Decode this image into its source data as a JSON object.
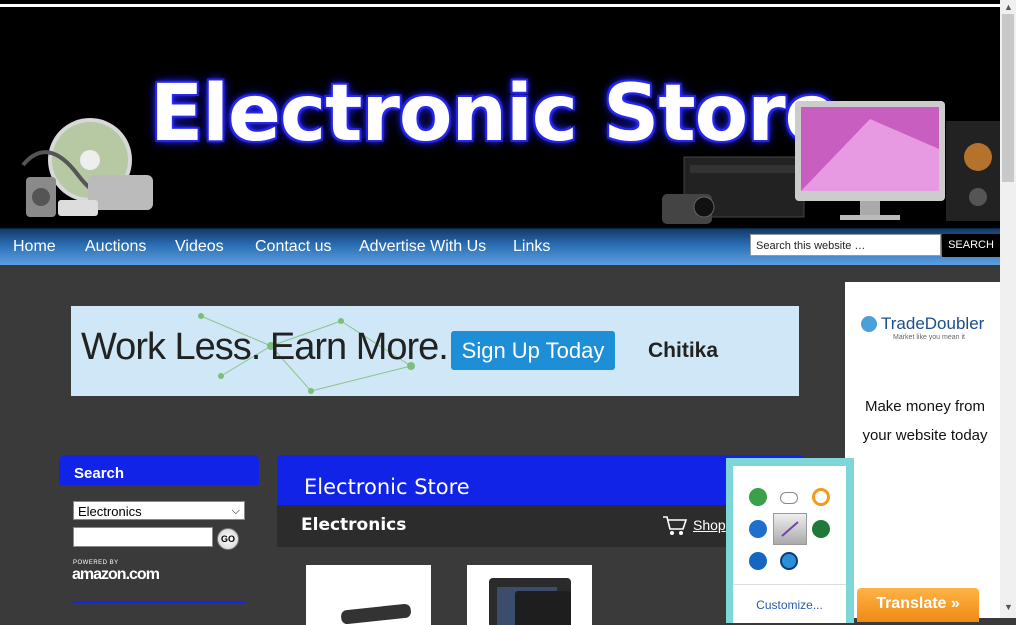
{
  "header": {
    "title": "Electronic Store"
  },
  "nav": {
    "items": [
      "Home",
      "Auctions",
      "Videos",
      "Contact us",
      "Advertise With Us",
      "Links"
    ]
  },
  "search": {
    "placeholder": "Search this website …",
    "button": "SEARCH"
  },
  "banner": {
    "headline": "Work Less. Earn More.",
    "cta": "Sign Up Today",
    "brand": "Chitika"
  },
  "side_ad": {
    "brand": "TradeDoubler",
    "tagline": "Market like you mean it",
    "text": "Make money from your website today"
  },
  "translate": {
    "label": "Translate »"
  },
  "widget": {
    "title": "Search",
    "category": "Electronics",
    "go": "GO",
    "powered": "POWERED BY",
    "amazon": "amazon.com"
  },
  "main": {
    "title": "Electronic Store",
    "category": "Electronics",
    "shop_link": "Shop"
  },
  "extensions": {
    "customize": "Customize...",
    "icons": [
      "utorrent-icon",
      "cloud-icon",
      "avast-icon",
      "teamviewer-icon",
      "pen-icon",
      "shield-icon",
      "grid-icon",
      "globe-icon"
    ]
  },
  "colors": {
    "nav_blue": "#2b6fb4",
    "widget_blue": "#1123e6",
    "ext_border": "#7fd6d9",
    "translate_orange": "#f08a14"
  }
}
